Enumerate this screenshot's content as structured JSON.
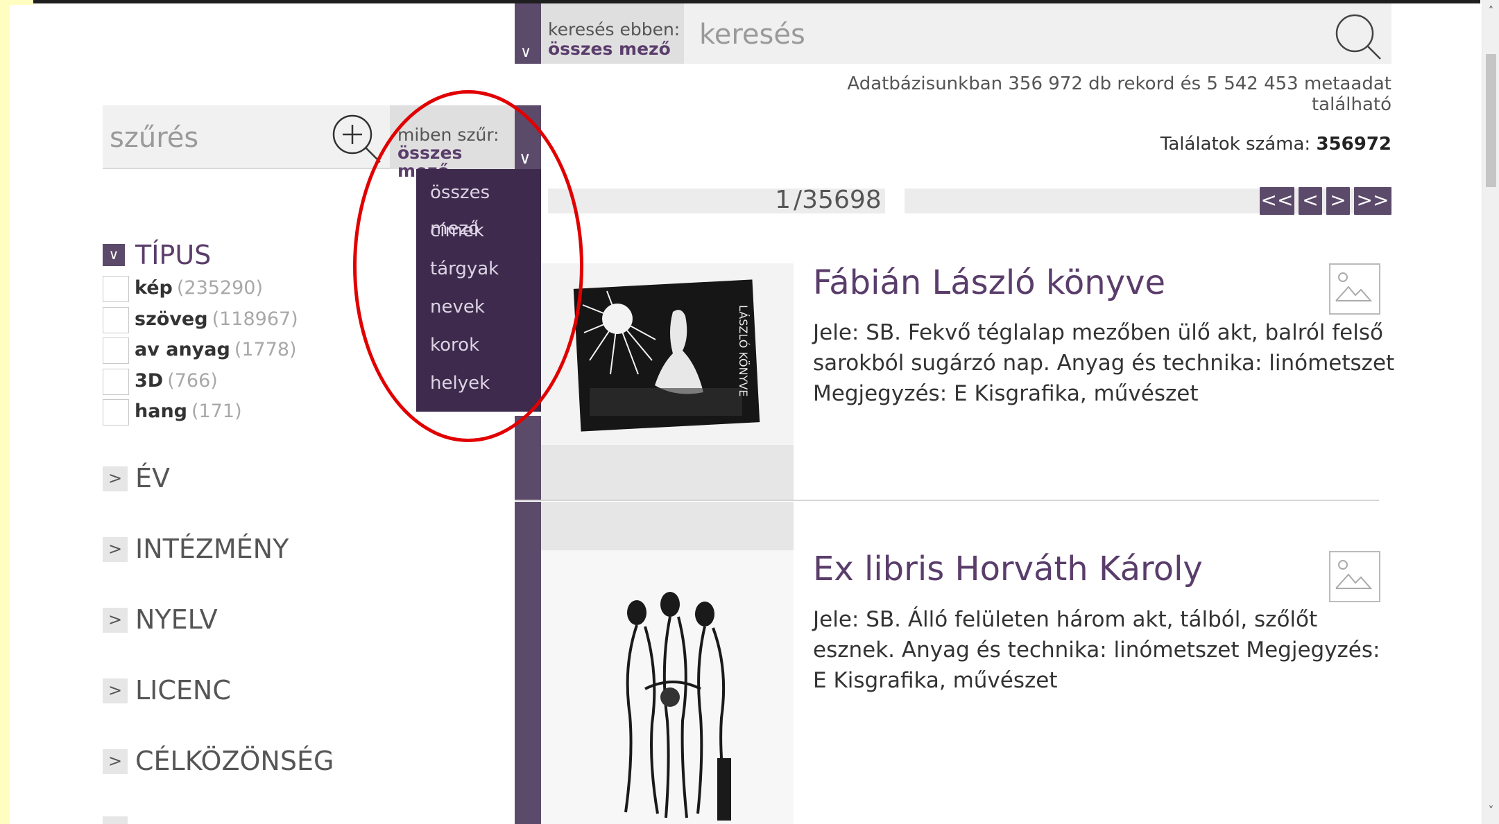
{
  "search": {
    "field_label": "keresés ebben:",
    "field_value": "összes mező",
    "placeholder": "keresés"
  },
  "stats": {
    "database_text": "Adatbázisunkban 356 972 db rekord és 5 542 453 metaadat található",
    "results_label": "Találatok száma:",
    "results_value": "356972"
  },
  "filter": {
    "placeholder": "szűrés",
    "field_label": "miben szűr:",
    "field_value": "összes mező",
    "options": [
      "összes mező",
      "címek",
      "tárgyak",
      "nevek",
      "korok",
      "helyek"
    ]
  },
  "facets": {
    "type": {
      "title": "TÍPUS",
      "items": [
        {
          "label": "kép",
          "count": "(235290)"
        },
        {
          "label": "szöveg",
          "count": "(118967)"
        },
        {
          "label": "av anyag",
          "count": "(1778)"
        },
        {
          "label": "3D",
          "count": "(766)"
        },
        {
          "label": "hang",
          "count": "(171)"
        }
      ]
    },
    "collapsed": [
      "ÉV",
      "INTÉZMÉNY",
      "NYELV",
      "LICENC",
      "CÉLKÖZÖNSÉG"
    ]
  },
  "pager": {
    "current": "1",
    "total": "/35698",
    "buttons": [
      "<<",
      "<",
      ">",
      ">>"
    ]
  },
  "results": [
    {
      "title": "Fábián László könyve",
      "description": "Jele: SB. Fekvő téglalap mezőben ülő akt, balról felső sarokból sugárzó nap. Anyag és technika: linómetszet Megjegyzés: E Kisgrafika, művészet"
    },
    {
      "title": "Ex libris Horváth Károly",
      "description": "Jele: SB. Álló felületen három akt, tálból, szőlőt esznek. Anyag és technika: linómetszet Megjegyzés: E Kisgrafika, művészet"
    }
  ],
  "colors": {
    "purple_dark": "#3d2a4c",
    "purple": "#5c4a6b",
    "accent_text": "#5a3d6b",
    "highlight_oval": "#e10000",
    "left_stripe": "#fffdc0"
  },
  "icons": {
    "search": "magnifier-icon",
    "filter_add": "plus-magnifier-icon",
    "image_type": "image-type-icon"
  }
}
